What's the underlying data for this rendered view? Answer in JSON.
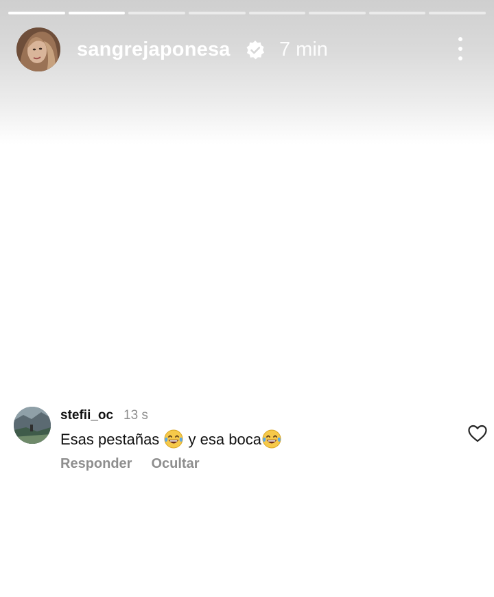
{
  "story": {
    "progress": {
      "total_segments": 8,
      "completed_segments": 2
    },
    "header": {
      "username": "sangrejaponesa",
      "verified": true,
      "time_ago": "7 min",
      "menu_icon": "more-vertical-icon"
    }
  },
  "comment": {
    "username": "stefii_oc",
    "time_ago": "13 s",
    "text_part1": "Esas pestañas ",
    "text_part2": " y esa boca",
    "emoji": "face-with-tears-of-joy",
    "actions": {
      "reply": "Responder",
      "hide": "Ocultar"
    },
    "like_icon": "heart-outline-icon"
  }
}
